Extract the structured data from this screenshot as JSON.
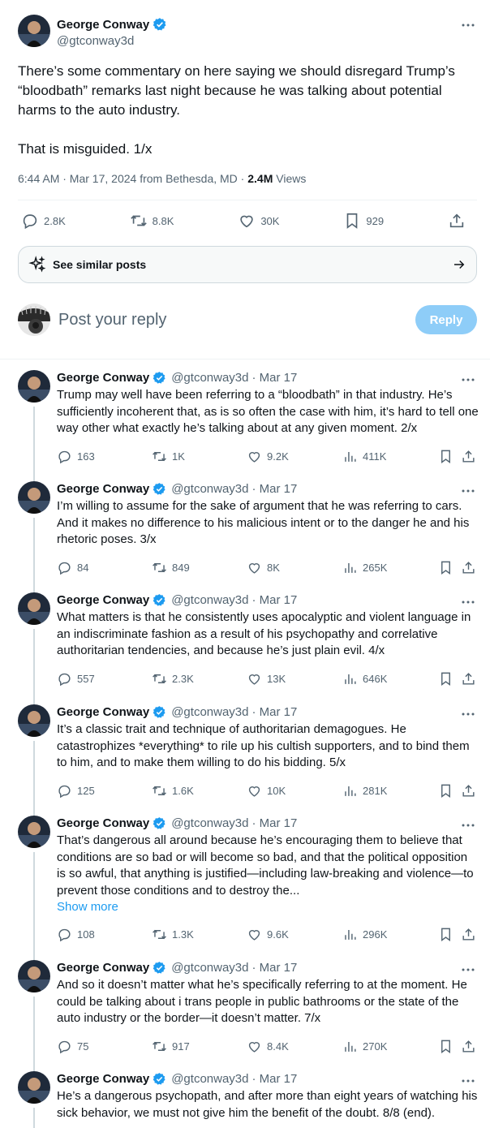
{
  "main_tweet": {
    "author": {
      "name": "George Conway",
      "handle": "@gtconway3d",
      "verified_icon": "verified-badge-icon"
    },
    "paragraphs": [
      "There’s some commentary on here saying we should disregard Trump’s “bloodbath” remarks last night because he was talking about potential harms to the auto industry.",
      "That is misguided. 1/x"
    ],
    "time": "6:44 AM · Mar 17, 2024 from Bethesda, MD · ",
    "views_count": "2.4M",
    "views_label": " Views",
    "stats": {
      "replies": "2.8K",
      "retweets": "8.8K",
      "likes": "30K",
      "bookmarks": "929"
    },
    "similar_label": "See similar posts",
    "reply_placeholder": "Post your reply",
    "reply_button": "Reply"
  },
  "replies": [
    {
      "name": "George Conway",
      "handle": "@gtconway3d",
      "date": "· Mar 17",
      "text": "Trump may well have been referring to a “bloodbath” in that industry.  He’s sufficiently incoherent that, as is so often the case with him, it’s hard to tell one way other what exactly he’s talking about at any given moment.  2/x",
      "show_more": "",
      "replies": "163",
      "retweets": "1K",
      "likes": "9.2K",
      "views": "411K"
    },
    {
      "name": "George Conway",
      "handle": "@gtconway3d",
      "date": "· Mar 17",
      "text": "I’m willing to assume for the sake of argument that he was referring to cars.  And it makes no difference to his malicious intent or to the danger he and his rhetoric poses.  3/x",
      "show_more": "",
      "replies": "84",
      "retweets": "849",
      "likes": "8K",
      "views": "265K"
    },
    {
      "name": "George Conway",
      "handle": "@gtconway3d",
      "date": "· Mar 17",
      "text": "What matters is that he consistently uses apocalyptic and violent language in an indiscriminate fashion as a result of his psychopathy and correlative authoritarian tendencies, and because he’s just plain evil.   4/x",
      "show_more": "",
      "replies": "557",
      "retweets": "2.3K",
      "likes": "13K",
      "views": "646K"
    },
    {
      "name": "George Conway",
      "handle": "@gtconway3d",
      "date": "· Mar 17",
      "text": "It’s a classic trait and technique of authoritarian demagogues.  He catastrophizes *everything* to rile up his cultish supporters, and to bind them to him, and to make them willing to do his bidding.   5/x",
      "show_more": "",
      "replies": "125",
      "retweets": "1.6K",
      "likes": "10K",
      "views": "281K"
    },
    {
      "name": "George Conway",
      "handle": "@gtconway3d",
      "date": "· Mar 17",
      "text": "That’s dangerous all around because he’s encouraging them to believe that conditions are so bad or will become so bad, and that the political opposition is so awful, that anything is justified—including law-breaking and violence—to prevent those conditions and to destroy the...",
      "show_more": "Show more",
      "replies": "108",
      "retweets": "1.3K",
      "likes": "9.6K",
      "views": "296K"
    },
    {
      "name": "George Conway",
      "handle": "@gtconway3d",
      "date": "· Mar 17",
      "text": "And so it doesn’t matter what he’s specifically referring to at the moment.  He could be talking about i trans people in public bathrooms or the state of the auto industry or the border—it doesn’t matter.  7/x",
      "show_more": "",
      "replies": "75",
      "retweets": "917",
      "likes": "8.4K",
      "views": "270K"
    },
    {
      "name": "George Conway",
      "handle": "@gtconway3d",
      "date": "· Mar 17",
      "text": "He’s a dangerous psychopath, and after more than eight years of watching his sick behavior, we must not give him the benefit of the doubt.  8/8 (end).",
      "show_more": "",
      "replies": "",
      "retweets": "",
      "likes": "",
      "views": ""
    }
  ],
  "colors": {
    "accent": "#1d9bf0",
    "text": "#0f1419",
    "muted": "#536471",
    "reply_button": "#8ecdf8"
  }
}
